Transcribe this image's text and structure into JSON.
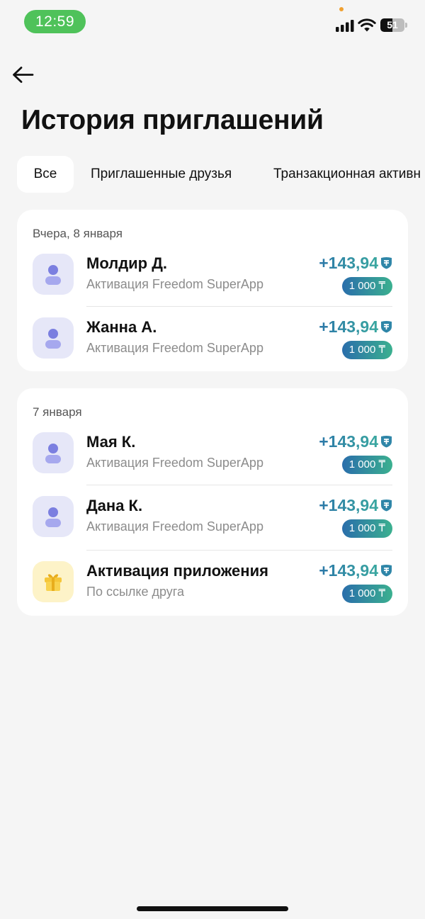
{
  "status_bar": {
    "time": "12:59",
    "battery": "51",
    "battery_level": 0.51
  },
  "header": {
    "title": "История приглашений"
  },
  "tabs": [
    {
      "label": "Все"
    },
    {
      "label": "Приглашенные друзья"
    },
    {
      "label": "Транзакционная активн"
    }
  ],
  "groups": [
    {
      "date": "Вчера, 8 января",
      "items": [
        {
          "name": "Молдир Д.",
          "subtitle": "Активация Freedom SuperApp",
          "amount": "+143,94",
          "badge": "1 000 ₸",
          "icon": "user-icon"
        },
        {
          "name": "Жанна А.",
          "subtitle": "Активация Freedom SuperApp",
          "amount": "+143,94",
          "badge": "1 000 ₸",
          "icon": "user-icon"
        }
      ]
    },
    {
      "date": "7 января",
      "items": [
        {
          "name": "Мая К.",
          "subtitle": "Активация Freedom SuperApp",
          "amount": "+143,94",
          "badge": "1 000 ₸",
          "icon": "user-icon"
        },
        {
          "name": "Дана К.",
          "subtitle": "Активация Freedom SuperApp",
          "amount": "+143,94",
          "badge": "1 000 ₸",
          "icon": "user-icon"
        },
        {
          "name": "Активация приложения",
          "subtitle": "По ссылке друга",
          "amount": "+143,94",
          "badge": "1 000 ₸",
          "icon": "gift-icon"
        }
      ]
    }
  ],
  "colors": {
    "accent_green": "#4fc25a",
    "amount_gradient_start": "#2b77a8",
    "amount_gradient_end": "#3aa8a0"
  }
}
